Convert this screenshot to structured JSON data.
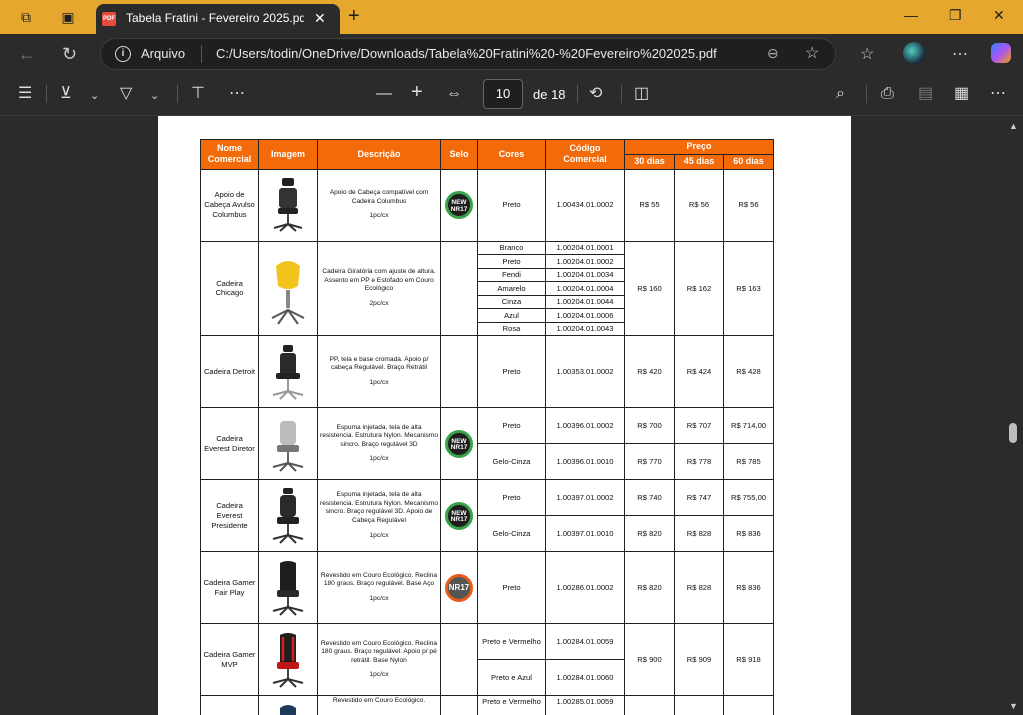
{
  "browser": {
    "tab_title": "Tabela Fratini - Fevereiro 2025.pdf",
    "tab_badge": "PDF",
    "address_scheme": "Arquivo",
    "url": "C:/Users/todin/OneDrive/Downloads/Tabela%20Fratini%20-%20Fevereiro%202025.pdf"
  },
  "pdf_toolbar": {
    "current_page": "10",
    "page_total_label": "de 18"
  },
  "table": {
    "headers": {
      "nome": "Nome Comercial",
      "imagem": "Imagem",
      "descricao": "Descrição",
      "selo": "Selo",
      "cores": "Cores",
      "codigo": "Código Comercial",
      "preco": "Preço",
      "d30": "30 dias",
      "d45": "45 dias",
      "d60": "60 dias"
    },
    "products": [
      {
        "name": "Apoio de Cabeça Avulso Columbus",
        "desc": "Apoio de Cabeça compatível com Cadeira Columbus",
        "pack": "1pc/cx",
        "seal": "NEW NR17",
        "rows": [
          {
            "color": "Preto",
            "code": "1.00434.01.0002",
            "p30": "R$ 55",
            "p45": "R$ 56",
            "p60": "R$ 56"
          }
        ]
      },
      {
        "name": "Cadeira Chicago",
        "desc": "Cadeira Giratória com ajuste de altura. Assento em PP e Estofado em Couro Ecológico",
        "pack": "2pc/cx",
        "seal": "",
        "p30": "R$ 160",
        "p45": "R$ 162",
        "p60": "R$ 163",
        "rows": [
          {
            "color": "Branco",
            "code": "1.00204.01.0001"
          },
          {
            "color": "Preto",
            "code": "1.00204.01.0002"
          },
          {
            "color": "Fendi",
            "code": "1.00204.01.0034"
          },
          {
            "color": "Amarelo",
            "code": "1.00204.01.0004"
          },
          {
            "color": "Cinza",
            "code": "1.00204.01.0044"
          },
          {
            "color": "Azul",
            "code": "1.00204.01.0006"
          },
          {
            "color": "Rosa",
            "code": "1.00204.01.0043"
          }
        ]
      },
      {
        "name": "Cadeira Detroit",
        "desc": "PP, tela e base cromada. Apoio p/ cabeça Regulável. Braço Retrátil",
        "pack": "1pc/cx",
        "seal": "",
        "rows": [
          {
            "color": "Preto",
            "code": "1.00353.01.0002",
            "p30": "R$ 420",
            "p45": "R$ 424",
            "p60": "R$ 428"
          }
        ]
      },
      {
        "name": "Cadeira Everest Diretor",
        "desc": "Espuma injetada, tela de alta resistencia. Estrutura Nylon. Mecanismo sincro. Braço regulável 3D",
        "pack": "1pc/cx",
        "seal": "NEW NR17",
        "rows": [
          {
            "color": "Preto",
            "code": "1.00396.01.0002",
            "p30": "R$ 700",
            "p45": "R$ 707",
            "p60": "R$   714,00"
          },
          {
            "color": "Gelo-Cinza",
            "code": "1.00396.01.0010",
            "p30": "R$ 770",
            "p45": "R$ 778",
            "p60": "R$ 785"
          }
        ]
      },
      {
        "name": "Cadeira Everest Presidente",
        "desc": "Espuma injetada, tela de alta resistencia. Estrutura Nylon. Mecanismo sincro. Braço regulável 3D. Apoio de Cabeça Regulável",
        "pack": "1pc/cx",
        "seal": "NEW NR17",
        "rows": [
          {
            "color": "Preto",
            "code": "1.00397.01.0002",
            "p30": "R$ 740",
            "p45": "R$ 747",
            "p60": "R$   755,00"
          },
          {
            "color": "Gelo-Cinza",
            "code": "1.00397.01.0010",
            "p30": "R$ 820",
            "p45": "R$ 828",
            "p60": "R$ 836"
          }
        ]
      },
      {
        "name": "Cadeira Gamer Fair Play",
        "desc": "Revestido em Couro Ecológico. Reclina 180 graus. Braço regulável. Base Aço",
        "pack": "1pc/cx",
        "seal": "NR17",
        "rows": [
          {
            "color": "Preto",
            "code": "1.00286.01.0002",
            "p30": "R$ 820",
            "p45": "R$ 828",
            "p60": "R$ 836"
          }
        ]
      },
      {
        "name": "Cadeira Gamer MVP",
        "desc": "Revestido em Couro Ecológico. Reclina 180 graus. Braço regulável. Apoio p/ pé retrátil. Base Nylon",
        "pack": "1pc/cx",
        "seal": "",
        "p30": "R$ 900",
        "p45": "R$ 909",
        "p60": "R$ 918",
        "rows": [
          {
            "color": "Preto e Vermelho",
            "code": "1.00284.01.0059"
          },
          {
            "color": "Preto e Azul",
            "code": "1.00284.01.0060"
          }
        ]
      },
      {
        "name": "",
        "desc": "Revestido em Couro Ecológico.",
        "rows": [
          {
            "color": "Preto e Vermelho",
            "code": "1.00285.01.0059"
          }
        ]
      }
    ]
  }
}
